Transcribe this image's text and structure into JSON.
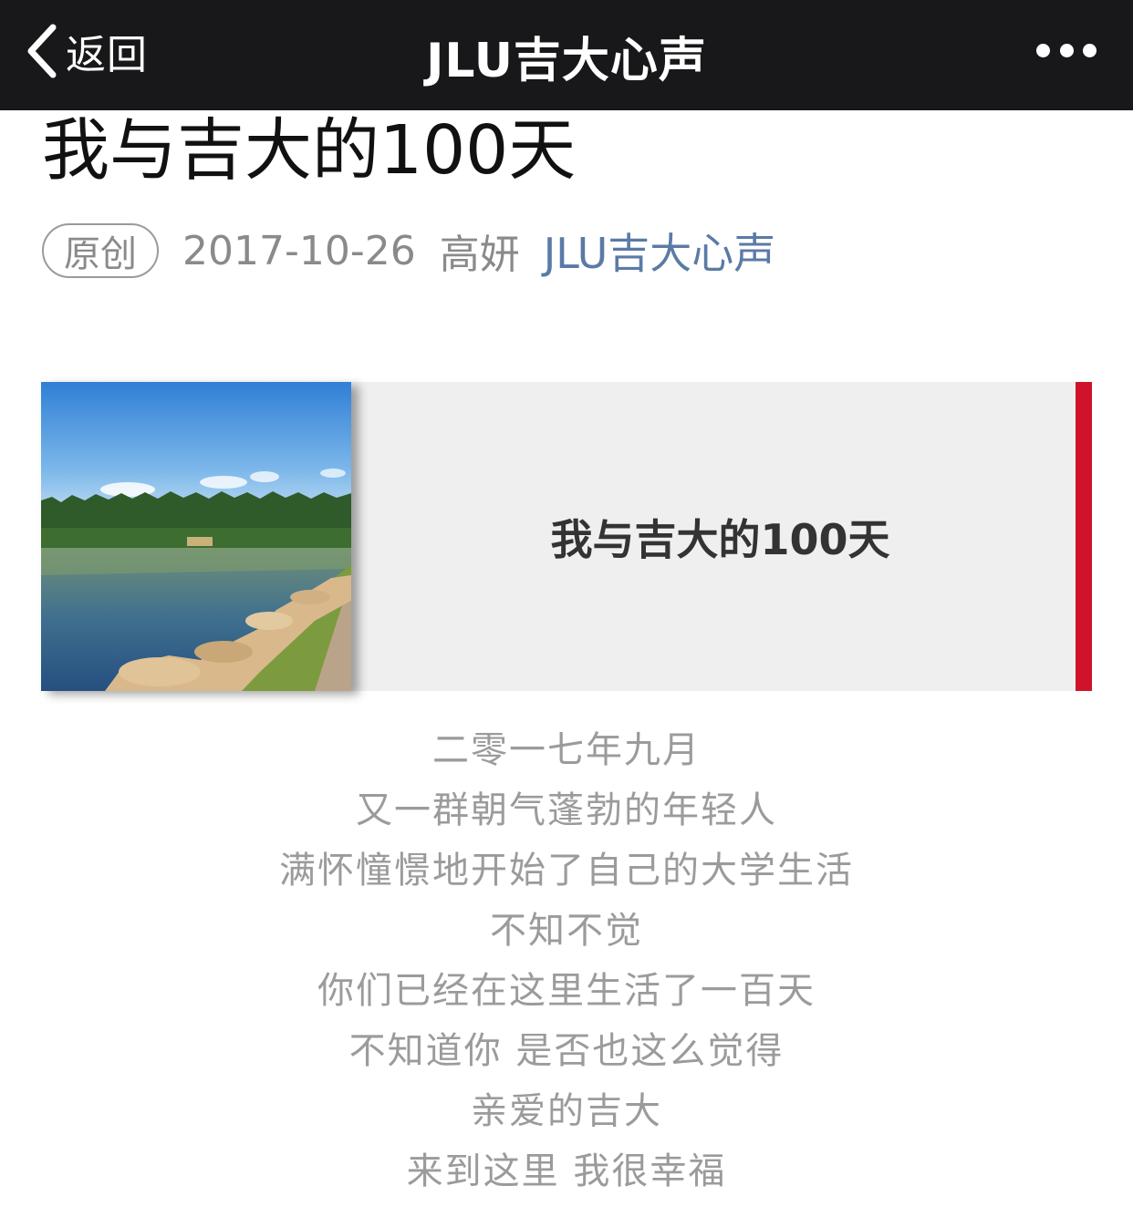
{
  "navbar": {
    "back_label": "返回",
    "title": "JLU吉大心声"
  },
  "article": {
    "title": "我与吉大的100天",
    "badge": "原创",
    "date": "2017-10-26",
    "author": "高妍",
    "account": "JLU吉大心声"
  },
  "banner": {
    "title": "我与吉大的100天",
    "accent_color": "#d0132a"
  },
  "poem": {
    "lines": [
      "二零一七年九月",
      "又一群朝气蓬勃的年轻人",
      "满怀憧憬地开始了自己的大学生活",
      "不知不觉",
      "你们已经在这里生活了一百天",
      "不知道你 是否也这么觉得",
      "亲爱的吉大",
      "来到这里 我很幸福"
    ]
  }
}
